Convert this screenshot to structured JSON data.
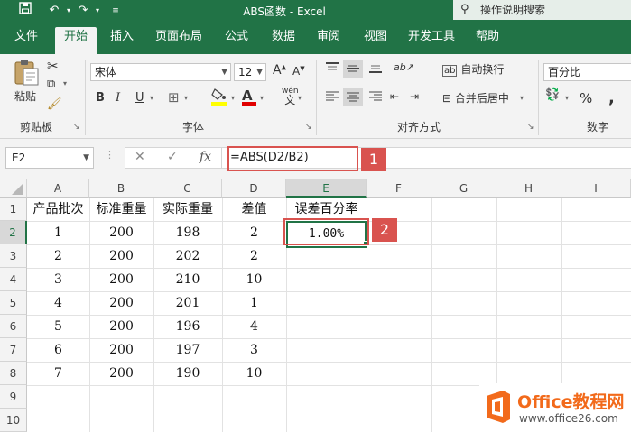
{
  "window": {
    "title": "ABS函数 - Excel"
  },
  "tell_me": {
    "placeholder": "操作说明搜索"
  },
  "tabs": [
    {
      "label": "文件"
    },
    {
      "label": "开始"
    },
    {
      "label": "插入"
    },
    {
      "label": "页面布局"
    },
    {
      "label": "公式"
    },
    {
      "label": "数据"
    },
    {
      "label": "审阅"
    },
    {
      "label": "视图"
    },
    {
      "label": "开发工具"
    },
    {
      "label": "帮助"
    }
  ],
  "ribbon": {
    "clipboard": {
      "label": "剪贴板",
      "paste_label": "粘贴"
    },
    "font": {
      "label": "字体",
      "name": "宋体",
      "size": "12",
      "bold": "B",
      "italic": "I",
      "underline": "U",
      "wen_label": "wén",
      "grow_label": "A",
      "shrink_label": "A",
      "color_label": "A"
    },
    "align": {
      "label": "对齐方式",
      "wrap_label": "自动换行",
      "merge_label": "合并后居中",
      "orient_label": "ab"
    },
    "number": {
      "label": "数字",
      "format": "百分比",
      "percent_label": "%",
      "comma_label": ","
    }
  },
  "formula_bar": {
    "name_box": "E2",
    "formula": "=ABS(D2/B2)"
  },
  "callouts": {
    "one": "1",
    "two": "2"
  },
  "columns": [
    "A",
    "B",
    "C",
    "D",
    "E",
    "F",
    "G",
    "H",
    "I"
  ],
  "row_numbers": [
    "1",
    "2",
    "3",
    "4",
    "5",
    "6",
    "7",
    "8",
    "9",
    "10"
  ],
  "headers": [
    "产品批次",
    "标准重量",
    "实际重量",
    "差值",
    "误差百分率"
  ],
  "rows": [
    [
      "1",
      "200",
      "198",
      "2",
      "1.00%"
    ],
    [
      "2",
      "200",
      "202",
      "2",
      ""
    ],
    [
      "3",
      "200",
      "210",
      "10",
      ""
    ],
    [
      "4",
      "200",
      "201",
      "1",
      ""
    ],
    [
      "5",
      "200",
      "196",
      "4",
      ""
    ],
    [
      "6",
      "200",
      "197",
      "3",
      ""
    ],
    [
      "7",
      "200",
      "190",
      "10",
      ""
    ]
  ],
  "watermark": {
    "brand": "Office教程网",
    "url": "www.office26.com",
    "accent": "#f26a1b"
  },
  "colors": {
    "excel_green": "#217346",
    "callout_red": "#d9534f"
  }
}
